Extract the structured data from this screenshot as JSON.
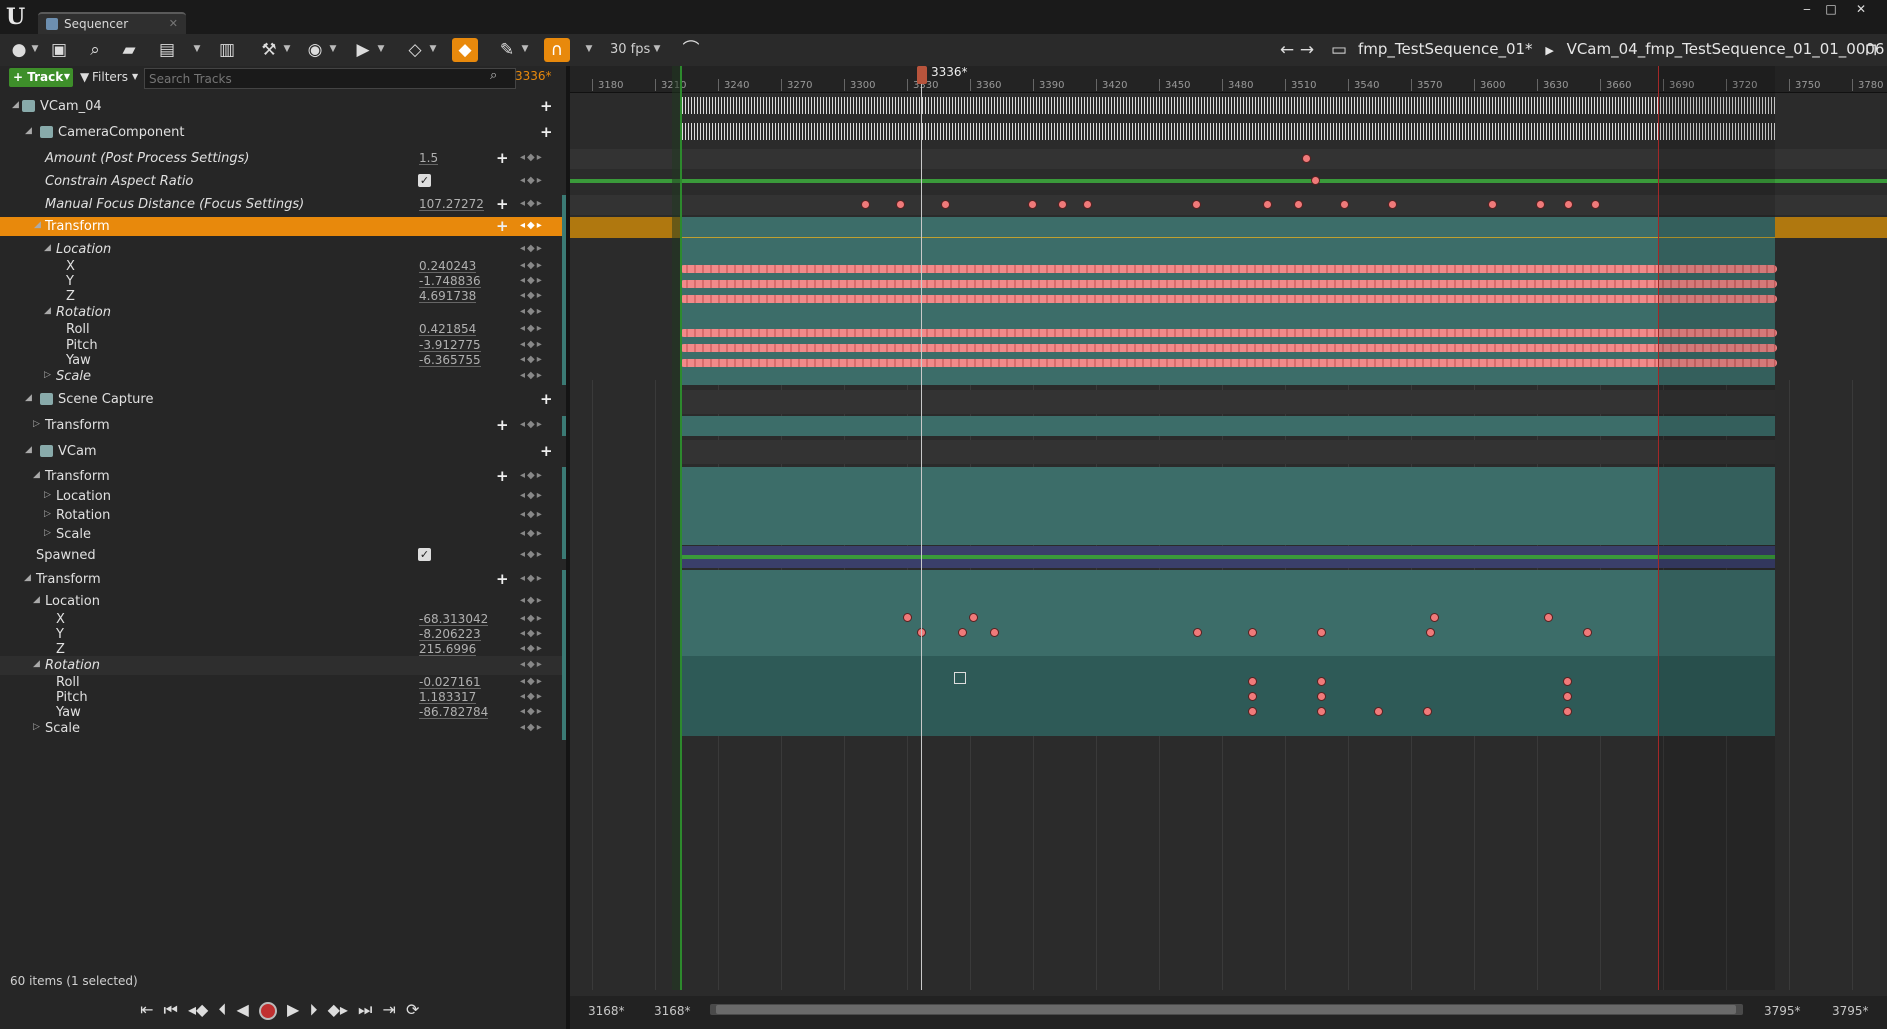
{
  "window": {
    "tab_title": "Sequencer",
    "logo": "U",
    "controls": [
      "‒",
      "□",
      "✕"
    ]
  },
  "toolbar": {
    "fps": "30 fps",
    "breadcrumb_sequence": "fmp_TestSequence_01*",
    "breadcrumb_shot": "VCam_04_fmp_TestSequence_01_01_0006",
    "accent": "#e8890c"
  },
  "tracks_panel": {
    "add_track": "+ Track",
    "filters": "Filters",
    "search_placeholder": "Search Tracks",
    "current_frame": "3336*",
    "status": "60 items (1 selected)"
  },
  "tracks": [
    {
      "label": "VCam_04",
      "indent": 0,
      "type": "actor",
      "plus": true
    },
    {
      "label": "CameraComponent",
      "indent": 1,
      "type": "component",
      "plus": true
    },
    {
      "label": "Amount (Post Process Settings)",
      "value": "1.5",
      "italic": true,
      "plus": true
    },
    {
      "label": "Constrain Aspect Ratio",
      "checkbox": true,
      "italic": true
    },
    {
      "label": "Manual Focus Distance (Focus Settings)",
      "value": "107.27272",
      "italic": true,
      "plus": true
    },
    {
      "label": "Transform",
      "selected": true,
      "plus": true
    },
    {
      "label": "Location",
      "italic": true
    },
    {
      "label": "X",
      "value": "0.240243"
    },
    {
      "label": "Y",
      "value": "-1.748836"
    },
    {
      "label": "Z",
      "value": "4.691738"
    },
    {
      "label": "Rotation",
      "italic": true
    },
    {
      "label": "Roll",
      "value": "0.421854"
    },
    {
      "label": "Pitch",
      "value": "-3.912775"
    },
    {
      "label": "Yaw",
      "value": "-6.365755"
    },
    {
      "label": "Scale",
      "italic": true
    },
    {
      "label": "Scene Capture",
      "type": "component",
      "plus": true
    },
    {
      "label": "Transform",
      "plus": true
    },
    {
      "label": "VCam",
      "type": "component",
      "plus": true
    },
    {
      "label": "Transform",
      "plus": true
    },
    {
      "label": "Location"
    },
    {
      "label": "Rotation"
    },
    {
      "label": "Scale"
    },
    {
      "label": "Spawned",
      "checkbox": true
    },
    {
      "label": "Transform",
      "plus": true
    },
    {
      "label": "Location"
    },
    {
      "label": "X",
      "value": "-68.313042"
    },
    {
      "label": "Y",
      "value": "-8.206223"
    },
    {
      "label": "Z",
      "value": "215.6996"
    },
    {
      "label": "Rotation",
      "italic": true
    },
    {
      "label": "Roll",
      "value": "-0.027161"
    },
    {
      "label": "Pitch",
      "value": "1.183317"
    },
    {
      "label": "Yaw",
      "value": "-86.782784"
    },
    {
      "label": "Scale"
    }
  ],
  "timeline": {
    "playhead_label": "3336*",
    "ruler_labels": [
      "3180",
      "3210",
      "3240",
      "3270",
      "3300",
      "3330",
      "3360",
      "3390",
      "3420",
      "3450",
      "3480",
      "3510",
      "3540",
      "3570",
      "3600",
      "3630",
      "3660",
      "3690",
      "3720",
      "3750",
      "3780"
    ],
    "view_start": "3168*",
    "work_start": "3168*",
    "work_end": "3795*",
    "view_end": "3795*"
  },
  "transport": {
    "icons": [
      "jump-to-start-icon",
      "prev-key-icon",
      "step-back-icon",
      "play-reverse-icon",
      "record-icon",
      "play-icon",
      "step-forward-icon",
      "next-key-icon",
      "jump-to-end-icon",
      "loop-icon"
    ]
  }
}
